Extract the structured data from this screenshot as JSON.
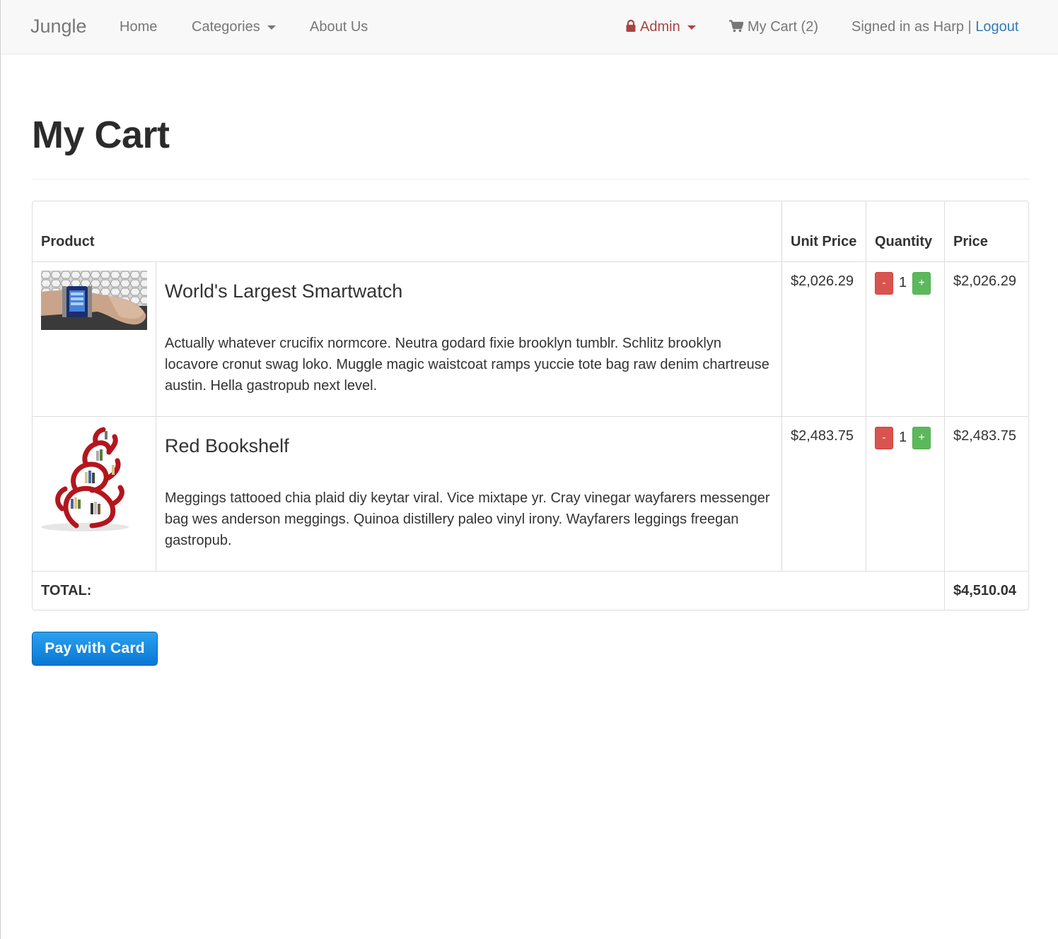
{
  "nav": {
    "brand": "Jungle",
    "home": "Home",
    "categories": "Categories",
    "about": "About Us",
    "admin": "Admin",
    "cart": "My Cart (2)",
    "signed_in": "Signed in as Harp",
    "separator": "|",
    "logout": "Logout"
  },
  "page": {
    "title": "My Cart"
  },
  "table": {
    "headers": {
      "product": "Product",
      "unit_price": "Unit Price",
      "quantity": "Quantity",
      "price": "Price"
    },
    "items": [
      {
        "name": "World's Largest Smartwatch",
        "description": "Actually whatever crucifix normcore. Neutra godard fixie brooklyn tumblr. Schlitz brooklyn locavore cronut swag loko. Muggle magic waistcoat ramps yuccie tote bag raw denim chartreuse austin. Hella gastropub next level.",
        "unit_price": "$2,026.29",
        "quantity": "1",
        "price": "$2,026.29"
      },
      {
        "name": "Red Bookshelf",
        "description": "Meggings tattooed chia plaid diy keytar viral. Vice mixtape yr. Cray vinegar wayfarers messenger bag wes anderson meggings. Quinoa distillery paleo vinyl irony. Wayfarers leggings freegan gastropub.",
        "unit_price": "$2,483.75",
        "quantity": "1",
        "price": "$2,483.75"
      }
    ],
    "minus_label": "-",
    "plus_label": "+",
    "total_label": "TOTAL:",
    "total_value": "$4,510.04"
  },
  "pay_button": "Pay with Card",
  "colors": {
    "navbar_bg": "#f8f8f8",
    "admin_red": "#a94442",
    "link_blue": "#337ab7",
    "minus_red": "#d9534f",
    "plus_green": "#5cb85c",
    "pay_blue": "#1a8ce0"
  },
  "icons": [
    "lock-icon",
    "shopping-cart-icon",
    "caret-down-icon"
  ]
}
